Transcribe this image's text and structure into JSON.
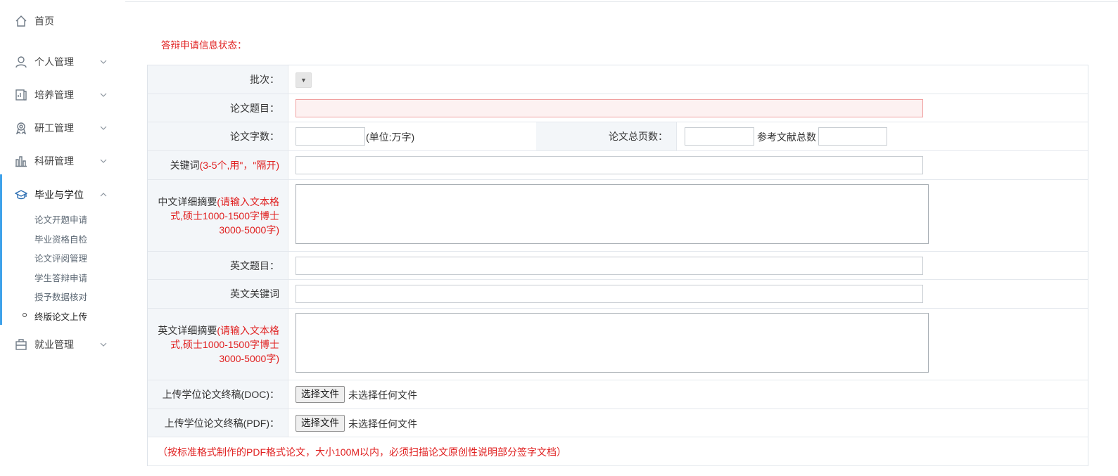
{
  "sidebar": {
    "items": [
      {
        "label": "首页",
        "icon": "home-icon"
      },
      {
        "label": "个人管理",
        "icon": "user-icon"
      },
      {
        "label": "培养管理",
        "icon": "chart-book-icon"
      },
      {
        "label": "研工管理",
        "icon": "award-icon"
      },
      {
        "label": "科研管理",
        "icon": "bar-chart-icon"
      },
      {
        "label": "毕业与学位",
        "icon": "graduation-cap-icon"
      },
      {
        "label": "就业管理",
        "icon": "briefcase-icon"
      }
    ],
    "sub_items": [
      "论文开题申请",
      "毕业资格自检",
      "论文评阅管理",
      "学生答辩申请",
      "授予数据核对",
      "终版论文上传"
    ],
    "active_color": "#3fa2ea"
  },
  "main": {
    "status_title": "答辩申请信息状态：",
    "form": {
      "batch_label": "批次：",
      "batch_select_value": "",
      "title_label": "论文题目：",
      "title_value": "",
      "word_count_label": "论文字数：",
      "word_count_value": "",
      "word_count_unit": "(单位:万字)",
      "total_pages_label": "论文总页数：",
      "total_pages_value": "",
      "references_label": "参考文献总数",
      "references_value": "",
      "keywords_label": "关键词 ",
      "keywords_hint": "(3-5个,用\"，\"隔开)",
      "keywords_value": "",
      "cn_abstract_label": "中文详细摘要",
      "cn_abstract_hint": "(请输入文本格式,硕士1000-1500字博士3000-5000字)",
      "cn_abstract_value": "",
      "en_title_label": "英文题目：",
      "en_title_value": "",
      "en_keywords_label": "英文关键词",
      "en_keywords_value": "",
      "en_abstract_label": "英文详细摘要",
      "en_abstract_hint": "(请输入文本格式,硕士1000-1500字博士3000-5000字)",
      "en_abstract_value": "",
      "upload_doc_label": "上传学位论文终稿(DOC)：",
      "upload_pdf_label": "上传学位论文终稿(PDF)：",
      "choose_file_label": "选择文件",
      "no_file_text": "未选择任何文件",
      "pdf_note": "（按标准格式制作的PDF格式论文，大小100M以内，必须扫描论文原创性说明部分签字文档）"
    },
    "colors": {
      "warning_red": "#e02020",
      "label_bg": "#f3f6f9"
    }
  }
}
